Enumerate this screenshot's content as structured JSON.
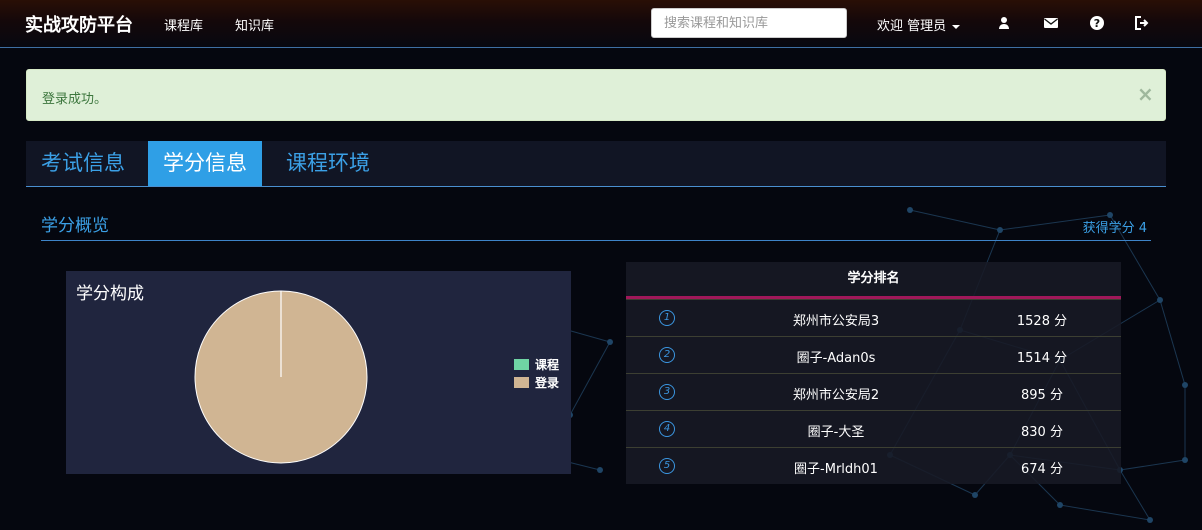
{
  "navbar": {
    "brand": "实战攻防平台",
    "links": [
      "课程库",
      "知识库"
    ],
    "search_placeholder": "搜索课程和知识库",
    "welcome": "欢迎 管理员",
    "icons": [
      "user-icon",
      "envelope-icon",
      "question-icon",
      "sign-out-icon"
    ]
  },
  "alert": {
    "message": "登录成功。",
    "close": "×"
  },
  "tabs": [
    {
      "label": "考试信息",
      "active": false
    },
    {
      "label": "学分信息",
      "active": true
    },
    {
      "label": "课程环境",
      "active": false
    }
  ],
  "section": {
    "title": "学分概览",
    "credit": "获得学分 4"
  },
  "chart": {
    "title": "学分构成"
  },
  "chart_data": {
    "type": "pie",
    "title": "学分构成",
    "categories": [
      "课程",
      "登录"
    ],
    "values": [
      0,
      4
    ],
    "colors": [
      "#6fd4a4",
      "#d0b593"
    ],
    "legend": "right"
  },
  "ranking": {
    "title": "学分排名",
    "rows": [
      {
        "rank": "1",
        "name": "郑州市公安局3",
        "score": "1528 分"
      },
      {
        "rank": "2",
        "name": "圈子-Adan0s",
        "score": "1514 分"
      },
      {
        "rank": "3",
        "name": "郑州市公安局2",
        "score": "895 分"
      },
      {
        "rank": "4",
        "name": "圈子-大圣",
        "score": "830 分"
      },
      {
        "rank": "5",
        "name": "圈子-Mrldh01",
        "score": "674 分"
      }
    ]
  }
}
